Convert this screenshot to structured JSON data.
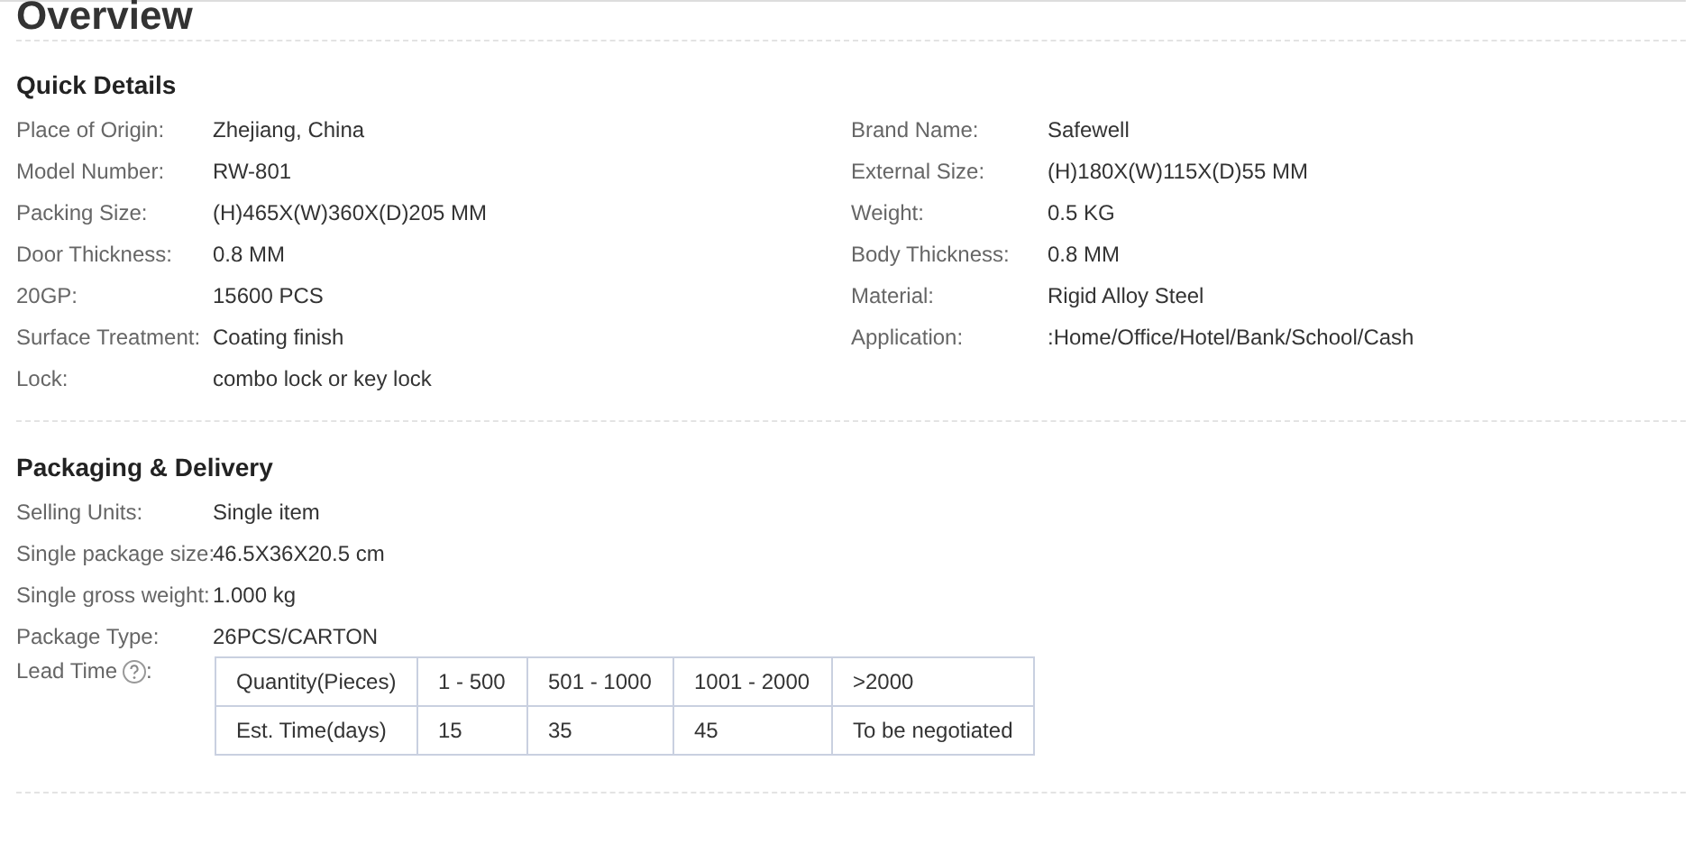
{
  "title": "Overview",
  "quick_details": {
    "heading": "Quick Details",
    "left": [
      {
        "label": "Place of Origin:",
        "value": "Zhejiang, China"
      },
      {
        "label": "Model Number:",
        "value": "RW-801"
      },
      {
        "label": "Packing Size:",
        "value": "(H)465X(W)360X(D)205 MM"
      },
      {
        "label": "Door Thickness:",
        "value": "0.8 MM"
      },
      {
        "label": "20GP:",
        "value": "15600 PCS"
      },
      {
        "label": "Surface Treatment:",
        "value": "Coating finish"
      },
      {
        "label": "Lock:",
        "value": "combo lock or key lock"
      }
    ],
    "right": [
      {
        "label": "Brand Name:",
        "value": "Safewell"
      },
      {
        "label": "External Size:",
        "value": "(H)180X(W)115X(D)55 MM"
      },
      {
        "label": "Weight:",
        "value": "0.5 KG"
      },
      {
        "label": "Body Thickness:",
        "value": "0.8 MM"
      },
      {
        "label": "Material:",
        "value": "Rigid Alloy Steel"
      },
      {
        "label": "Application:",
        "value": ":Home/Office/Hotel/Bank/School/Cash"
      }
    ]
  },
  "packaging": {
    "heading": "Packaging & Delivery",
    "rows": [
      {
        "label": "Selling Units:",
        "value": "Single item"
      },
      {
        "label": "Single package size:",
        "value": "46.5X36X20.5 cm"
      },
      {
        "label": "Single gross weight:",
        "value": "1.000 kg"
      },
      {
        "label": "Package Type:",
        "value": "26PCS/CARTON"
      }
    ],
    "lead_time": {
      "label": "Lead Time",
      "suffix": ":",
      "rows": [
        [
          "Quantity(Pieces)",
          "1 - 500",
          "501 - 1000",
          "1001 - 2000",
          ">2000"
        ],
        [
          "Est. Time(days)",
          "15",
          "35",
          "45",
          "To be negotiated"
        ]
      ]
    }
  }
}
